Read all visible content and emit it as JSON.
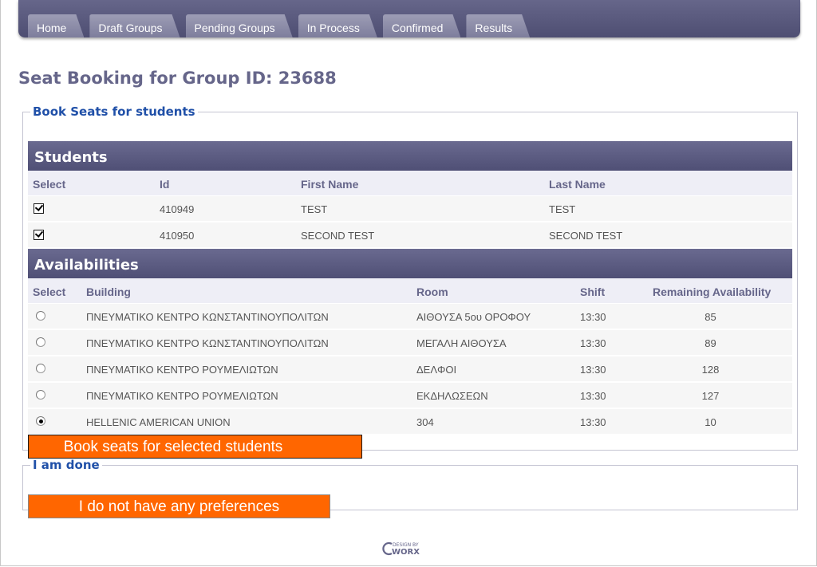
{
  "nav": {
    "tabs": [
      "Home",
      "Draft Groups",
      "Pending Groups",
      "In Process",
      "Confirmed",
      "Results"
    ]
  },
  "page": {
    "title": "Seat Booking for Group ID: 23688"
  },
  "book_section": {
    "legend": "Book Seats for students",
    "students": {
      "header": "Students",
      "columns": [
        "Select",
        "Id",
        "First Name",
        "Last Name"
      ],
      "rows": [
        {
          "checked": true,
          "id": "410949",
          "first_name": "TEST",
          "last_name": "TEST"
        },
        {
          "checked": true,
          "id": "410950",
          "first_name": "SECOND TEST",
          "last_name": "SECOND TEST"
        }
      ]
    },
    "availabilities": {
      "header": "Availabilities",
      "columns": [
        "Select",
        "Building",
        "Room",
        "Shift",
        "Remaining Availability"
      ],
      "rows": [
        {
          "selected": false,
          "building": "ΠΝΕΥΜΑΤΙΚΟ ΚΕΝΤΡΟ ΚΩΝΣΤΑΝΤΙΝΟΥΠΟΛΙΤΩΝ",
          "room": "ΑΙΘΟΥΣΑ 5ου ΟΡΟΦΟΥ",
          "shift": "13:30",
          "remaining": "85"
        },
        {
          "selected": false,
          "building": "ΠΝΕΥΜΑΤΙΚΟ ΚΕΝΤΡΟ ΚΩΝΣΤΑΝΤΙΝΟΥΠΟΛΙΤΩΝ",
          "room": "ΜΕΓΑΛΗ ΑΙΘΟΥΣΑ",
          "shift": "13:30",
          "remaining": "89"
        },
        {
          "selected": false,
          "building": "ΠΝΕΥΜΑΤΙΚΟ ΚΕΝΤΡΟ ΡΟΥΜΕΛΙΩΤΩΝ",
          "room": "ΔΕΛΦΟΙ",
          "shift": "13:30",
          "remaining": "128"
        },
        {
          "selected": false,
          "building": "ΠΝΕΥΜΑΤΙΚΟ ΚΕΝΤΡΟ ΡΟΥΜΕΛΙΩΤΩΝ",
          "room": "ΕΚΔΗΛΩΣΕΩΝ",
          "shift": "13:30",
          "remaining": "127"
        },
        {
          "selected": true,
          "building": "HELLENIC AMERICAN UNION",
          "room": "304",
          "shift": "13:30",
          "remaining": "10"
        }
      ]
    },
    "book_button": "Book seats for selected students"
  },
  "done_section": {
    "legend": "I am done",
    "no_preference_button": "I do not have any preferences"
  },
  "footer": {
    "logo_small": "DESIGN BY",
    "logo_main": "WORX"
  },
  "colors": {
    "accent": "#66668a",
    "button": "#ff6600",
    "legend": "#2050a8"
  }
}
